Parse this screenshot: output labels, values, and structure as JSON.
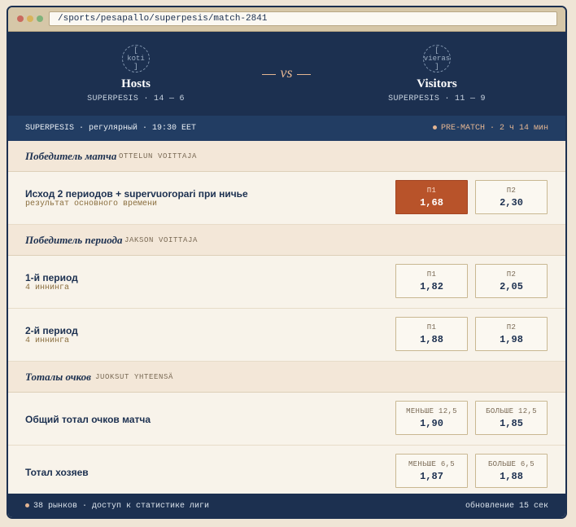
{
  "browser": {
    "url": "/sports/pesapallo/superpesis/match-2841"
  },
  "match": {
    "home": {
      "crest": "[ koti ]",
      "name": "Hosts",
      "record": "SUPERPESIS · 14 — 6"
    },
    "away": {
      "crest": "[ vieras ]",
      "name": "Visitors",
      "record": "SUPERPESIS · 11 — 9"
    },
    "vs": "vs"
  },
  "info": {
    "left": "SUPERPESIS · регулярный · 19:30 EET",
    "right": "PRE-MATCH · 2 ч 14 мин"
  },
  "sections": [
    {
      "title": "Победитель матча",
      "sub": "OTTELUN VOITTAJA",
      "markets": [
        {
          "name": "Исход 2 периодов + supervuoropari при ничье",
          "desc": "результат основного времени",
          "options": [
            {
              "label": "П1",
              "odd": "1,68",
              "selected": true
            },
            {
              "label": "П2",
              "odd": "2,30",
              "selected": false
            }
          ]
        }
      ]
    },
    {
      "title": "Победитель периода",
      "sub": "JAKSON VOITTAJA",
      "markets": [
        {
          "name": "1-й период",
          "desc": "4 иннинга",
          "options": [
            {
              "label": "П1",
              "odd": "1,82"
            },
            {
              "label": "П2",
              "odd": "2,05"
            }
          ]
        },
        {
          "name": "2-й период",
          "desc": "4 иннинга",
          "options": [
            {
              "label": "П1",
              "odd": "1,88"
            },
            {
              "label": "П2",
              "odd": "1,98"
            }
          ]
        }
      ]
    },
    {
      "title": "Тоталы очков",
      "sub": "JUOKSUT YHTEENSÄ",
      "markets": [
        {
          "name": "Общий тотал очков матча",
          "desc": "",
          "options": [
            {
              "label": "МЕНЬШЕ 12,5",
              "odd": "1,90"
            },
            {
              "label": "БОЛЬШЕ 12,5",
              "odd": "1,85"
            }
          ]
        },
        {
          "name": "Тотал хозяев",
          "desc": "",
          "options": [
            {
              "label": "МЕНЬШЕ 6,5",
              "odd": "1,87"
            },
            {
              "label": "БОЛЬШЕ 6,5",
              "odd": "1,88"
            }
          ]
        }
      ]
    }
  ],
  "footer": {
    "left": "38 рынков · доступ к статистике лиги",
    "right": "обновление 15 сек"
  },
  "colors": {
    "navy": "#1c3050",
    "accent": "#b8532a",
    "paper": "#f8f3ea"
  }
}
